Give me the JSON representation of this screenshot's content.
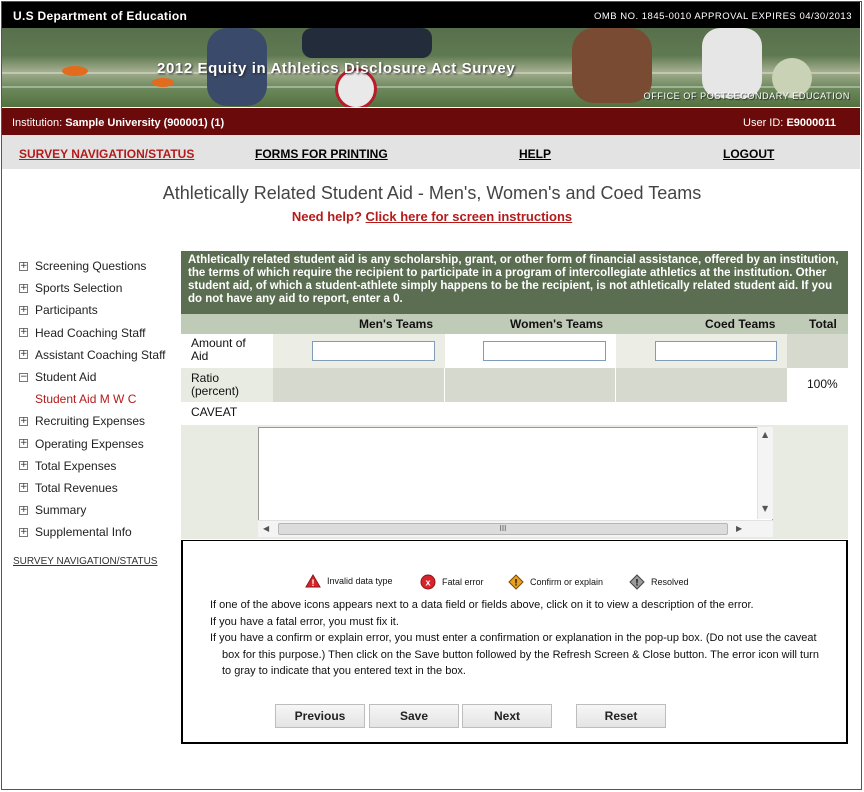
{
  "header": {
    "department": "U.S Department of Education",
    "omb": "OMB NO. 1845-0010 APPROVAL EXPIRES 04/30/2013",
    "banner_title": "2012 Equity in Athletics Disclosure Act Survey",
    "banner_office": "OFFICE OF POSTSECONDARY EDUCATION"
  },
  "institution_bar": {
    "label": "Institution:",
    "value": "Sample University (900001) (1)",
    "user_label": "User ID:",
    "user_value": "E9000011"
  },
  "nav": {
    "survey": "SURVEY NAVIGATION/STATUS",
    "forms": "FORMS FOR PRINTING",
    "help": "HELP",
    "logout": "LOGOUT"
  },
  "page": {
    "title": "Athletically Related Student Aid - Men's, Women's and Coed Teams",
    "help_prefix": "Need help?",
    "help_link": "Click here for screen instructions"
  },
  "sidebar": {
    "items": [
      {
        "label": "Screening Questions",
        "toggle": "+"
      },
      {
        "label": "Sports Selection",
        "toggle": "+"
      },
      {
        "label": "Participants",
        "toggle": "+"
      },
      {
        "label": "Head Coaching Staff",
        "toggle": "+"
      },
      {
        "label": "Assistant Coaching Staff",
        "toggle": "+"
      },
      {
        "label": "Student Aid",
        "toggle": "−"
      },
      {
        "label": "Student Aid M W C",
        "toggle": ""
      },
      {
        "label": "Recruiting Expenses",
        "toggle": "+"
      },
      {
        "label": "Operating Expenses",
        "toggle": "+"
      },
      {
        "label": "Total Expenses",
        "toggle": "+"
      },
      {
        "label": "Total Revenues",
        "toggle": "+"
      },
      {
        "label": "Summary",
        "toggle": "+"
      },
      {
        "label": "Supplemental Info",
        "toggle": "+"
      }
    ],
    "bottom_link": "SURVEY NAVIGATION/STATUS"
  },
  "info": {
    "text": "Athletically related student aid is any scholarship, grant, or other form of financial assistance, offered by an institution, the terms of which require the recipient to participate in a program of intercollegiate athletics at the institution.  Other student aid, of which a student-athlete simply happens to be the recipient, is not athletically related student aid.  If you do not have any aid to report, enter a 0."
  },
  "table": {
    "headers": {
      "men": "Men's Teams",
      "women": "Women's Teams",
      "coed": "Coed Teams",
      "total": "Total"
    },
    "amount_label": "Amount of Aid",
    "amount_values": {
      "men": "",
      "women": "",
      "coed": ""
    },
    "ratio_label": "Ratio (percent)",
    "ratio_total": "100%",
    "caveat_label": "CAVEAT",
    "caveat_value": "",
    "scroll_thumb": "III"
  },
  "legend": {
    "invalid": "Invalid data type",
    "fatal": "Fatal error",
    "confirm": "Confirm or explain",
    "resolved": "Resolved"
  },
  "messages": {
    "line1": "If one of the above icons appears next to a data field or fields above, click on it to view a description of the error.",
    "line2": "If you have a fatal error, you must fix it.",
    "line3": "If you have a confirm or explain error, you must enter a confirmation or explanation in the pop-up box. (Do not use the caveat box for this purpose.) Then click on the Save button followed by the Refresh Screen & Close button. The error icon will turn to gray to indicate that you entered text in the box."
  },
  "buttons": {
    "previous": "Previous",
    "save": "Save",
    "next": "Next",
    "reset": "Reset"
  },
  "colors": {
    "institution_bar": "#6b0a0a",
    "accent_red": "#b31b1b",
    "info_green": "#5b6e52",
    "table_header": "#c0cbb7",
    "table_row": "#e8ebe2",
    "table_cell": "#d6d9cd"
  }
}
